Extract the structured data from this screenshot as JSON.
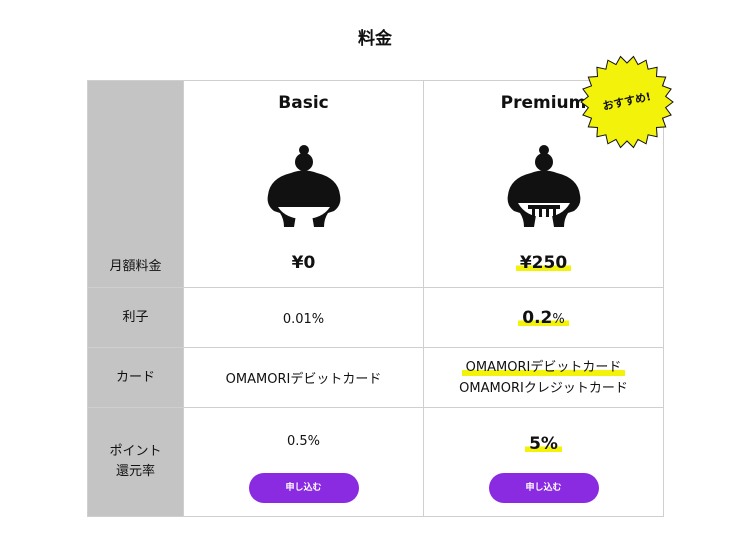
{
  "page": {
    "title": "料金"
  },
  "labels": {
    "monthly_fee": "月額料金",
    "interest": "利子",
    "card": "カード",
    "point_line1": "ポイント",
    "point_line2": "還元率"
  },
  "plans": [
    {
      "name": "Basic",
      "icon": "sumo-wrestler-icon",
      "price": "¥0",
      "interest": "0.01%",
      "cards": [
        "OMAMORIデビットカード"
      ],
      "point_rate": "0.5%",
      "apply_label": "申し込む"
    },
    {
      "name": "Premium",
      "icon": "sumo-wrestler-icon",
      "price": "¥250",
      "interest_num": "0.2",
      "interest_unit": "%",
      "cards": [
        "OMAMORIデビットカード",
        "OMAMORIクレジットカード"
      ],
      "point_rate": "5%",
      "apply_label": "申し込む"
    }
  ],
  "badge": {
    "text": "おすすめ!"
  },
  "colors": {
    "accent": "#8a2be2",
    "highlight": "#f2f20a",
    "label_bg": "#c4c4c4",
    "border": "#cfcfcf"
  }
}
